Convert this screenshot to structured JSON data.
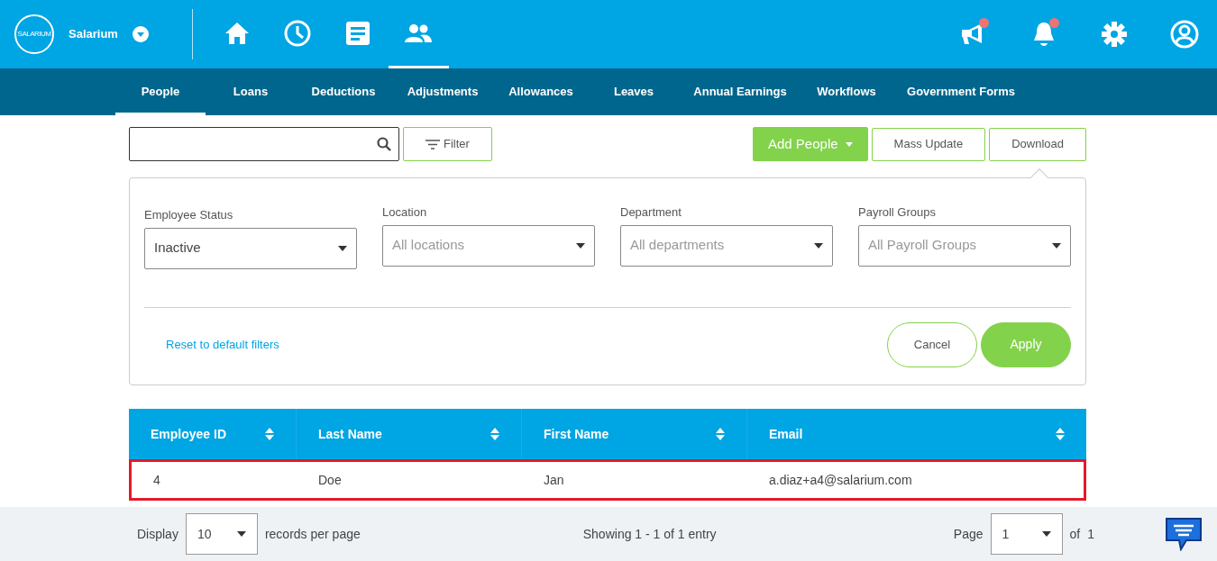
{
  "brand": {
    "logo_text": "SALARIUM",
    "name": "Salarium"
  },
  "top_icons": [
    {
      "kind": "home",
      "selected": false
    },
    {
      "kind": "clock",
      "selected": false
    },
    {
      "kind": "document",
      "selected": false
    },
    {
      "kind": "people",
      "selected": true
    }
  ],
  "right_icons": [
    {
      "kind": "megaphone",
      "badge": true
    },
    {
      "kind": "bell",
      "badge": true
    },
    {
      "kind": "gear",
      "badge": false
    },
    {
      "kind": "user",
      "badge": false
    }
  ],
  "tabs": [
    {
      "label": "People",
      "selected": true
    },
    {
      "label": "Loans",
      "selected": false
    },
    {
      "label": "Deductions",
      "selected": false
    },
    {
      "label": "Adjustments",
      "selected": false
    },
    {
      "label": "Allowances",
      "selected": false
    },
    {
      "label": "Leaves",
      "selected": false
    },
    {
      "label": "Annual Earnings",
      "selected": false
    },
    {
      "label": "Workflows",
      "selected": false
    },
    {
      "label": "Government Forms",
      "selected": false
    }
  ],
  "toolbar": {
    "filter_label": "Filter",
    "add_label": "Add People",
    "mass_update": "Mass Update",
    "download": "Download"
  },
  "filters": [
    {
      "label": "Employee Status",
      "value": "Inactive"
    },
    {
      "label": "Location",
      "placeholder": "All locations"
    },
    {
      "label": "Department",
      "placeholder": "All departments"
    },
    {
      "label": "Payroll Groups",
      "placeholder": "All Payroll Groups"
    }
  ],
  "filter_actions": {
    "reset": "Reset to default filters",
    "cancel": "Cancel",
    "apply": "Apply"
  },
  "table": {
    "columns": [
      "Employee ID",
      "Last Name",
      "First Name",
      "Email"
    ],
    "rows": [
      {
        "cells": [
          "4",
          "Doe",
          "Jan",
          "a.diaz+a4@salarium.com"
        ],
        "highlighted": true
      }
    ]
  },
  "pagination": {
    "display": "Display",
    "per_page": "10",
    "records": "records per page",
    "showing": "Showing 1 - 1 of 1 entry",
    "page_label": "Page",
    "page": "1",
    "of": "of",
    "total": "1"
  }
}
